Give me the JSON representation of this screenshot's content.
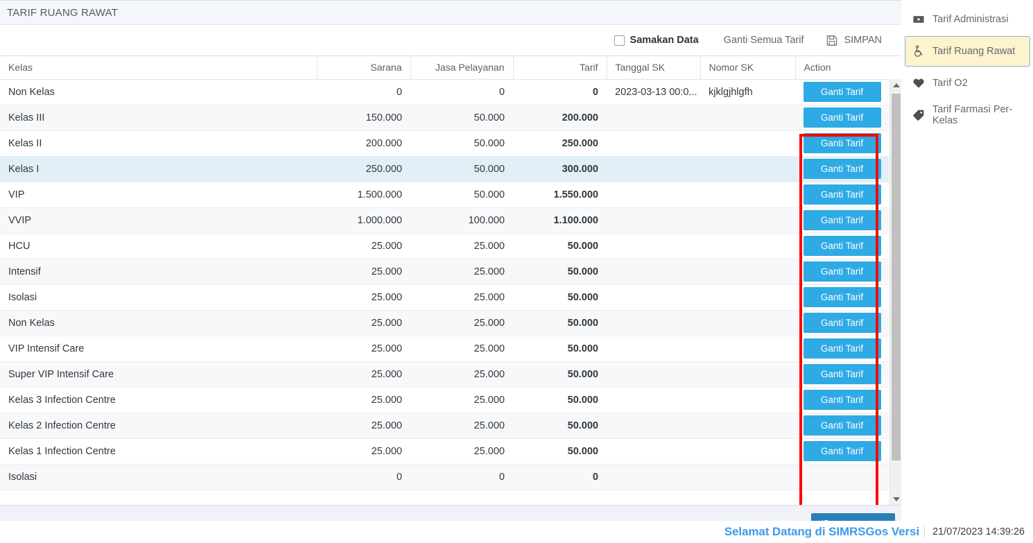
{
  "panel": {
    "title": "TARIF RUANG RAWAT"
  },
  "toolbar": {
    "samakan_data_label": "Samakan Data",
    "samakan_data_checked": false,
    "ganti_semua_label": "Ganti Semua Tarif",
    "simpan_label": "SIMPAN",
    "simpan_icon": "save-floppy-icon"
  },
  "table": {
    "columns": [
      "Kelas",
      "Sarana",
      "Jasa Pelayanan",
      "Tarif",
      "Tanggal SK",
      "Nomor SK",
      "Action"
    ],
    "action_button_label": "Ganti Tarif",
    "rows": [
      {
        "kelas": "Non Kelas",
        "sarana": "0",
        "jasa": "0",
        "tarif": "0",
        "tanggal_sk": "2023-03-13 00:0...",
        "nomor_sk": "kjklgjhlgfh",
        "style": "plain"
      },
      {
        "kelas": "Kelas III",
        "sarana": "150.000",
        "jasa": "50.000",
        "tarif": "200.000",
        "tanggal_sk": "",
        "nomor_sk": "",
        "style": "alt"
      },
      {
        "kelas": "Kelas II",
        "sarana": "200.000",
        "jasa": "50.000",
        "tarif": "250.000",
        "tanggal_sk": "",
        "nomor_sk": "",
        "style": "plain"
      },
      {
        "kelas": "Kelas I",
        "sarana": "250.000",
        "jasa": "50.000",
        "tarif": "300.000",
        "tanggal_sk": "",
        "nomor_sk": "",
        "style": "sel"
      },
      {
        "kelas": "VIP",
        "sarana": "1.500.000",
        "jasa": "50.000",
        "tarif": "1.550.000",
        "tanggal_sk": "",
        "nomor_sk": "",
        "style": "plain"
      },
      {
        "kelas": "VVIP",
        "sarana": "1.000.000",
        "jasa": "100.000",
        "tarif": "1.100.000",
        "tanggal_sk": "",
        "nomor_sk": "",
        "style": "alt"
      },
      {
        "kelas": "HCU",
        "sarana": "25.000",
        "jasa": "25.000",
        "tarif": "50.000",
        "tanggal_sk": "",
        "nomor_sk": "",
        "style": "plain"
      },
      {
        "kelas": "Intensif",
        "sarana": "25.000",
        "jasa": "25.000",
        "tarif": "50.000",
        "tanggal_sk": "",
        "nomor_sk": "",
        "style": "alt"
      },
      {
        "kelas": "Isolasi",
        "sarana": "25.000",
        "jasa": "25.000",
        "tarif": "50.000",
        "tanggal_sk": "",
        "nomor_sk": "",
        "style": "plain"
      },
      {
        "kelas": "Non Kelas",
        "sarana": "25.000",
        "jasa": "25.000",
        "tarif": "50.000",
        "tanggal_sk": "",
        "nomor_sk": "",
        "style": "alt"
      },
      {
        "kelas": "VIP Intensif Care",
        "sarana": "25.000",
        "jasa": "25.000",
        "tarif": "50.000",
        "tanggal_sk": "",
        "nomor_sk": "",
        "style": "plain"
      },
      {
        "kelas": "Super VIP Intensif Care",
        "sarana": "25.000",
        "jasa": "25.000",
        "tarif": "50.000",
        "tanggal_sk": "",
        "nomor_sk": "",
        "style": "alt"
      },
      {
        "kelas": "Kelas 3 Infection Centre",
        "sarana": "25.000",
        "jasa": "25.000",
        "tarif": "50.000",
        "tanggal_sk": "",
        "nomor_sk": "",
        "style": "plain"
      },
      {
        "kelas": "Kelas 2 Infection Centre",
        "sarana": "25.000",
        "jasa": "25.000",
        "tarif": "50.000",
        "tanggal_sk": "",
        "nomor_sk": "",
        "style": "alt"
      },
      {
        "kelas": "Kelas 1 Infection Centre",
        "sarana": "25.000",
        "jasa": "25.000",
        "tarif": "50.000",
        "tanggal_sk": "",
        "nomor_sk": "",
        "style": "plain"
      },
      {
        "kelas": "Isolasi",
        "sarana": "0",
        "jasa": "0",
        "tarif": "0",
        "tanggal_sk": "",
        "nomor_sk": "",
        "style": "alt"
      }
    ]
  },
  "footer": {
    "history_label": "HISTORY",
    "history_icon": "history-clock-icon"
  },
  "statusbar": {
    "welcome_text": "Selamat Datang di SIMRSGos Versi",
    "datetime": "21/07/2023 14:39:26"
  },
  "sidebar": {
    "items": [
      {
        "label": "Tarif Administrasi",
        "icon": "money-bill-icon",
        "active": false
      },
      {
        "label": "Tarif Ruang Rawat",
        "icon": "wheelchair-icon",
        "active": true
      },
      {
        "label": "Tarif O2",
        "icon": "heart-icon",
        "active": false
      },
      {
        "label": "Tarif Farmasi Per-Kelas",
        "icon": "tag-icon",
        "active": false
      }
    ]
  },
  "colors": {
    "action_button": "#2eaae4",
    "highlight_box": "#ff0000",
    "history_button": "#2a7fb8",
    "active_nav": "#fdf3cd",
    "selected_row": "#e3eff7",
    "welcome_text": "#3d9ae8"
  }
}
